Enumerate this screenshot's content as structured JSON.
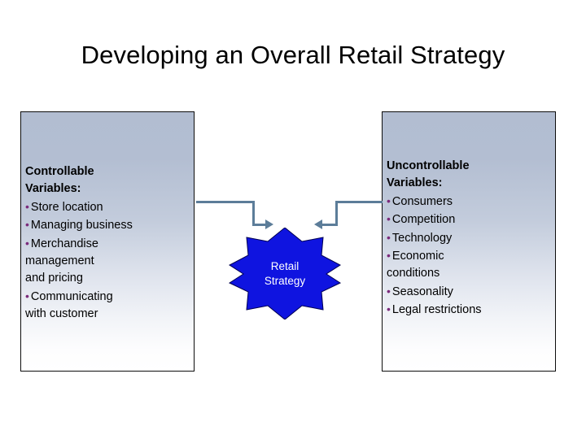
{
  "slide": {
    "title": "Developing an Overall Retail Strategy",
    "background_color": "#ffffff"
  },
  "colors": {
    "box_gradient_top": "#b2bdd1",
    "box_gradient_bottom": "#ffffff",
    "box_border": "#0d0d0d",
    "bullet": "#7b2a7b",
    "connector": "#5c7d99",
    "star_fill": "#0f14e0",
    "star_text": "#ffffff",
    "title_text": "#000000"
  },
  "boxes": {
    "controllable": {
      "heading_lines": [
        "Controllable",
        "Variables:"
      ],
      "lines": [
        {
          "bullet": true,
          "text": "Store location"
        },
        {
          "bullet": true,
          "text": "Managing business"
        },
        {
          "bullet": true,
          "text": "Merchandise"
        },
        {
          "bullet": false,
          "text": "management"
        },
        {
          "bullet": false,
          "text": "and pricing"
        },
        {
          "bullet": true,
          "text": "Communicating"
        },
        {
          "bullet": false,
          "text": "with customer"
        }
      ]
    },
    "uncontrollable": {
      "heading_lines": [
        "Uncontrollable",
        "Variables:"
      ],
      "lines": [
        {
          "bullet": true,
          "text": "Consumers"
        },
        {
          "bullet": true,
          "text": "Competition"
        },
        {
          "bullet": true,
          "text": "Technology"
        },
        {
          "bullet": true,
          "text": "Economic"
        },
        {
          "bullet": false,
          "text": "conditions"
        },
        {
          "bullet": true,
          "text": "Seasonality"
        },
        {
          "bullet": true,
          "text": "Legal restrictions"
        }
      ]
    }
  },
  "center": {
    "shape": "eight-point-star",
    "label_lines": [
      "Retail",
      "Strategy"
    ]
  },
  "connectors": [
    {
      "name": "controllable-to-strategy",
      "direction": "right",
      "style": "elbow-arrow"
    },
    {
      "name": "uncontrollable-to-strategy",
      "direction": "left",
      "style": "elbow-arrow"
    }
  ],
  "bullet_glyph": "•"
}
